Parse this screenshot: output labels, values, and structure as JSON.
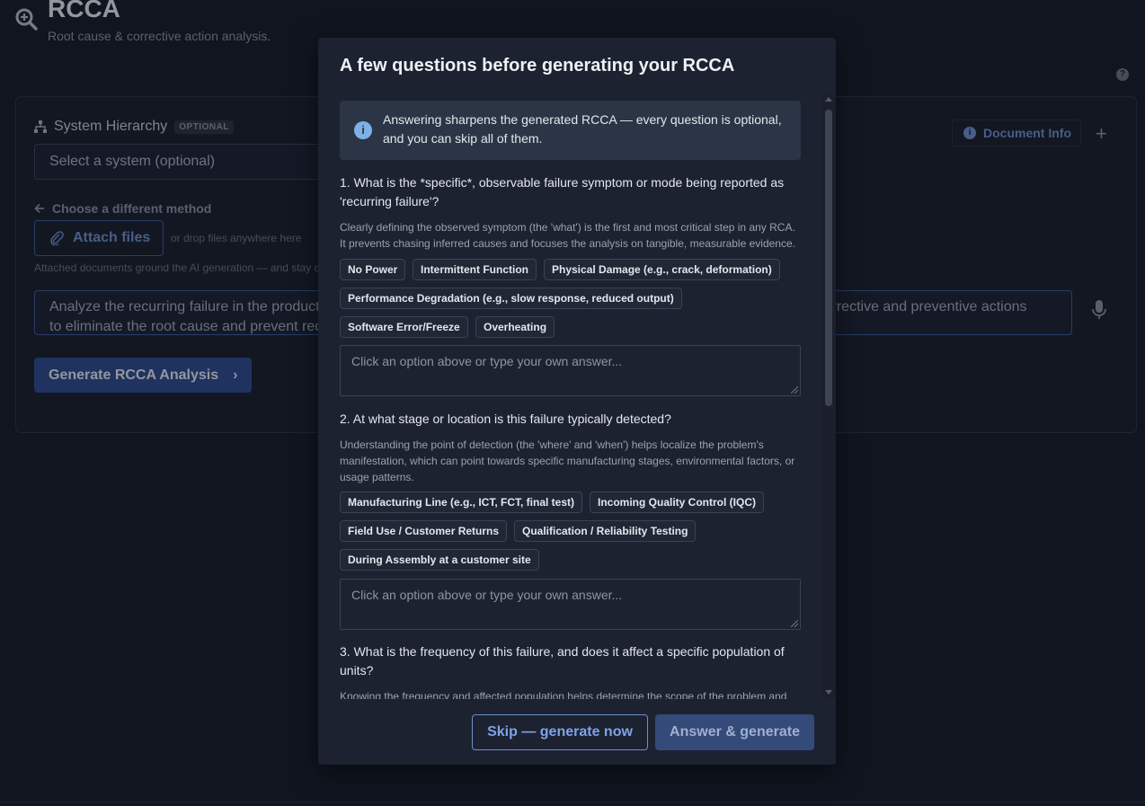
{
  "app": {
    "title": "RCCA",
    "subtitle": "Root cause & corrective action analysis.",
    "help_icon": "question-circle-icon"
  },
  "panel": {
    "system_hierarchy_label": "System Hierarchy",
    "optional_badge": "OPTIONAL",
    "system_select_placeholder": "Select a system (optional)",
    "document_info_label": "Document Info",
    "choose_different_method": "Choose a different method",
    "attach_files_label": "Attach files",
    "drop_hint": "or drop files anywhere here",
    "attach_note": "Attached documents ground the AI generation — and stay c",
    "prompt_line1_left": "Analyze the recurring failure in the product",
    "prompt_line1_right": "orrective and preventive actions",
    "prompt_line2_left": "to eliminate the root cause and prevent rec",
    "generate_label": "Generate RCCA Analysis",
    "generate_chevron": "›"
  },
  "modal": {
    "title": "A few questions before generating your RCCA",
    "info_text": "Answering sharpens the generated RCCA — every question is optional, and you can skip all of them.",
    "questions": [
      {
        "title": "1. What is the *specific*, observable failure symptom or mode being reported as 'recurring failure'?",
        "description": "Clearly defining the observed symptom (the 'what') is the first and most critical step in any RCA. It prevents chasing inferred causes and focuses the analysis on tangible, measurable evidence.",
        "options": [
          "No Power",
          "Intermittent Function",
          "Physical Damage (e.g., crack, deformation)",
          "Performance Degradation (e.g., slow response, reduced output)",
          "Software Error/Freeze",
          "Overheating"
        ],
        "placeholder": "Click an option above or type your own answer..."
      },
      {
        "title": "2. At what stage or location is this failure typically detected?",
        "description": "Understanding the point of detection (the 'where' and 'when') helps localize the problem's manifestation, which can point towards specific manufacturing stages, environmental factors, or usage patterns.",
        "options": [
          "Manufacturing Line (e.g., ICT, FCT, final test)",
          "Incoming Quality Control (IQC)",
          "Field Use / Customer Returns",
          "Qualification / Reliability Testing",
          "During Assembly at a customer site"
        ],
        "placeholder": "Click an option above or type your own answer..."
      },
      {
        "title": "3. What is the frequency of this failure, and does it affect a specific population of units?",
        "description": "Knowing the frequency and affected population helps determine the scope of the problem and"
      }
    ],
    "skip_label": "Skip — generate now",
    "answer_label": "Answer & generate"
  }
}
